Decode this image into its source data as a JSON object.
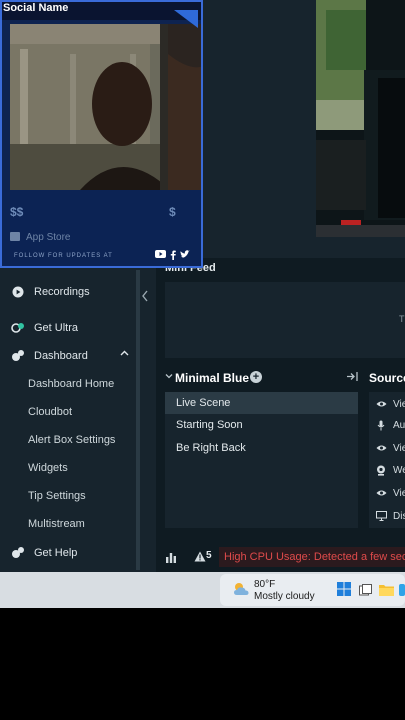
{
  "overlay": {
    "title": "Social Name",
    "dollar_left": "$$",
    "dollar_right": "$",
    "app_store": "App Store",
    "follow_text": "FOLLOW FOR UPDATES AT",
    "social_icons": [
      "youtube-icon",
      "facebook-icon",
      "twitter-icon"
    ]
  },
  "sidebar": {
    "items": [
      {
        "label": "Recordings",
        "icon": "play-circle-icon"
      },
      {
        "label": "Get Ultra",
        "icon": "ultra-icon"
      },
      {
        "label": "Dashboard",
        "icon": "dashboard-icon"
      }
    ],
    "dashboard_subitems": [
      "Dashboard Home",
      "Cloudbot",
      "Alert Box Settings",
      "Widgets",
      "Tip Settings",
      "Multistream"
    ],
    "help": {
      "label": "Get Help",
      "icon": "help-icon"
    }
  },
  "mini_feed": {
    "title": "Mini Feed",
    "edge_text": "T"
  },
  "scenes": {
    "collection_name": "Minimal Blue",
    "items": [
      "Live Scene",
      "Starting Soon",
      "Be Right Back"
    ],
    "active_index": 0
  },
  "sources": {
    "title": "Source",
    "items": [
      {
        "label": "Vie",
        "icon": "eye-icon"
      },
      {
        "label": "Aud",
        "icon": "microphone-icon"
      },
      {
        "label": "Vie",
        "icon": "eye-icon"
      },
      {
        "label": "We",
        "icon": "webcam-icon"
      },
      {
        "label": "Vie",
        "icon": "eye-icon"
      },
      {
        "label": "Dis",
        "icon": "monitor-icon"
      }
    ]
  },
  "footer": {
    "alert_count": "5",
    "cpu_warning": "High CPU Usage: Detected a few seconds"
  },
  "taskbar": {
    "temperature": "80°F",
    "condition": "Mostly cloudy"
  },
  "colors": {
    "accent": "#3a6bd8",
    "warning": "#e04b4b",
    "panel": "#17242d"
  }
}
